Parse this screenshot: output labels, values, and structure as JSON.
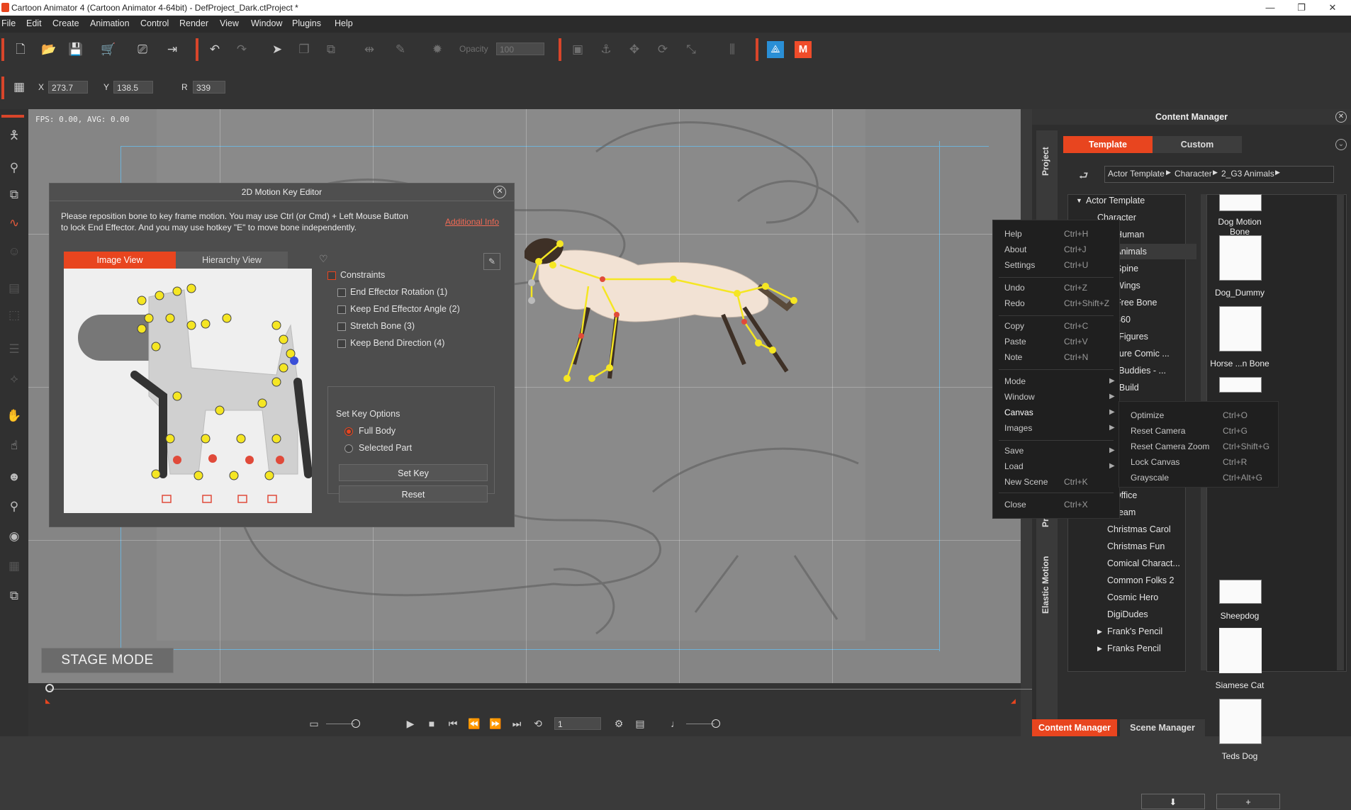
{
  "window": {
    "title": "Cartoon Animator 4  (Cartoon Animator 4-64bit) - DefProject_Dark.ctProject *",
    "minimize": "—",
    "restore": "❐",
    "close": "✕"
  },
  "menu": [
    "File",
    "Edit",
    "Create",
    "Animation",
    "Control",
    "Render",
    "View",
    "Window",
    "Plugins",
    "Help"
  ],
  "toolbar2": {
    "x_label": "X",
    "x_value": "273.7",
    "y_label": "Y",
    "y_value": "138.5",
    "r_label": "R",
    "r_value": "339"
  },
  "toolbar1": {
    "opacity_label": "Opacity",
    "opacity_value": "100"
  },
  "stage": {
    "fps_text": "FPS: 0.00, AVG: 0.00",
    "mode_label": "STAGE MODE"
  },
  "motion_key_editor": {
    "title": "2D Motion Key Editor",
    "message": "Please reposition bone to key frame motion. You may use Ctrl (or Cmd) + Left Mouse Button to lock End Effector. And you may use hotkey \"E\" to move bone independently.",
    "link": "Additional Info",
    "tabs": [
      "Image View",
      "Hierarchy View"
    ],
    "constraints_label": "Constraints",
    "constraints": [
      {
        "label": "End Effector Rotation (1)",
        "checked": false
      },
      {
        "label": "Keep End Effector Angle (2)",
        "checked": false
      },
      {
        "label": "Stretch Bone (3)",
        "checked": false
      },
      {
        "label": "Keep Bend Direction (4)",
        "checked": false
      }
    ],
    "set_key_options_label": "Set Key Options",
    "options": [
      {
        "label": "Full Body",
        "selected": true
      },
      {
        "label": "Selected Part",
        "selected": false
      }
    ],
    "set_key_button": "Set Key",
    "reset_button": "Reset"
  },
  "context_menu": {
    "items": [
      {
        "label": "Help",
        "shortcut": "Ctrl+H"
      },
      {
        "label": "About",
        "shortcut": "Ctrl+J"
      },
      {
        "label": "Settings",
        "shortcut": "Ctrl+U"
      },
      {
        "label": "Undo",
        "shortcut": "Ctrl+Z"
      },
      {
        "label": "Redo",
        "shortcut": "Ctrl+Shift+Z"
      },
      {
        "label": "Copy",
        "shortcut": "Ctrl+C"
      },
      {
        "label": "Paste",
        "shortcut": "Ctrl+V"
      },
      {
        "label": "Note",
        "shortcut": "Ctrl+N"
      },
      {
        "label": "Mode",
        "shortcut": ""
      },
      {
        "label": "Window",
        "shortcut": ""
      },
      {
        "label": "Canvas",
        "shortcut": ""
      },
      {
        "label": "Images",
        "shortcut": ""
      },
      {
        "label": "Save",
        "shortcut": ""
      },
      {
        "label": "Load",
        "shortcut": ""
      },
      {
        "label": "New Scene",
        "shortcut": "Ctrl+K"
      },
      {
        "label": "Close",
        "shortcut": "Ctrl+X"
      }
    ],
    "submenu": [
      {
        "label": "Optimize",
        "shortcut": "Ctrl+O"
      },
      {
        "label": "Reset Camera",
        "shortcut": "Ctrl+G"
      },
      {
        "label": "Reset Camera Zoom",
        "shortcut": "Ctrl+Shift+G"
      },
      {
        "label": "Lock Canvas",
        "shortcut": "Ctrl+R"
      },
      {
        "label": "Grayscale",
        "shortcut": "Ctrl+Alt+G"
      }
    ]
  },
  "content_manager": {
    "title": "Content Manager",
    "side_tabs": [
      "Project",
      "Pr",
      "Elastic Motion"
    ],
    "tabs": [
      "Template",
      "Custom"
    ],
    "breadcrumb": [
      "Actor Template",
      "Character",
      "2_G3 Animals"
    ],
    "tree": [
      "Actor Template",
      "Character",
      "2_G3 Human",
      "2_G3 Animals",
      "2_G3 Spine",
      "2_G3 Wings",
      "2_G3 Free Bone",
      "2_G3 360",
      "Action Figures",
      "Adventure Comic ...",
      "Bibble Buddies - ...",
      "Buddy Build",
      "Chibi Office",
      "Chibi Team",
      "Christmas Carol",
      "Christmas Fun",
      "Comical Charact...",
      "Common Folks 2",
      "Cosmic Hero",
      "DigiDudes",
      "Frank's Pencil",
      "Franks Pencil"
    ],
    "thumbs": [
      "Dog Motion Bone",
      "Dog_Dummy",
      "Horse ...n Bone",
      "Sheepdog",
      "Siamese Cat",
      "Teds Dog"
    ],
    "bottom_tabs": [
      "Content Manager",
      "Scene Manager"
    ]
  },
  "timeline": {
    "frame_value": "1"
  },
  "colors": {
    "accent": "#e8451f",
    "yellow_joint": "#f5e623",
    "red_joint": "#e04a3a"
  }
}
